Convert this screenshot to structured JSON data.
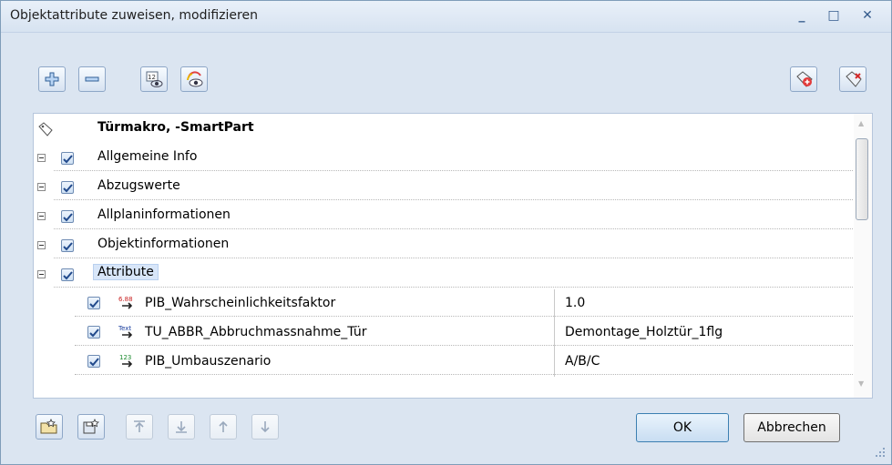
{
  "window": {
    "title": "Objektattribute zuweisen, modifizieren",
    "minimize": "_",
    "maximize": "□",
    "close": "✕"
  },
  "toolbar": {
    "expand_all": "expand-plus-icon",
    "collapse_all": "collapse-minus-icon",
    "show_numbers": "attribute-number-icon",
    "color_view": "color-eye-icon",
    "add_attribute": "tag-add-icon",
    "remove_attribute": "tag-delete-icon"
  },
  "tree": {
    "root": "Türmakro, -SmartPart",
    "groups": [
      {
        "label": "Allgemeine Info",
        "checked": true
      },
      {
        "label": "Abzugswerte",
        "checked": true
      },
      {
        "label": "Allplaninformationen",
        "checked": true
      },
      {
        "label": "Objektinformationen",
        "checked": true
      },
      {
        "label": "Attribute",
        "checked": true,
        "selected": true
      }
    ],
    "attributes": [
      {
        "name": "PIB_Wahrscheinlichkeitsfaktor",
        "type_icon": "number-format-icon",
        "value": "1.0",
        "checked": true
      },
      {
        "name": "TU_ABBR_Abbruchmassnahme_Tür",
        "type_icon": "text-format-icon",
        "value": "Demontage_Holztür_1flg",
        "checked": true
      },
      {
        "name": "PIB_Umbauszenario",
        "type_icon": "integer-format-icon",
        "value": "A/B/C",
        "checked": true
      }
    ]
  },
  "footer": {
    "ok_label": "OK",
    "cancel_label": "Abbrechen"
  },
  "colors": {
    "accent": "#3c7fb1",
    "selection": "#d8e6f9"
  }
}
